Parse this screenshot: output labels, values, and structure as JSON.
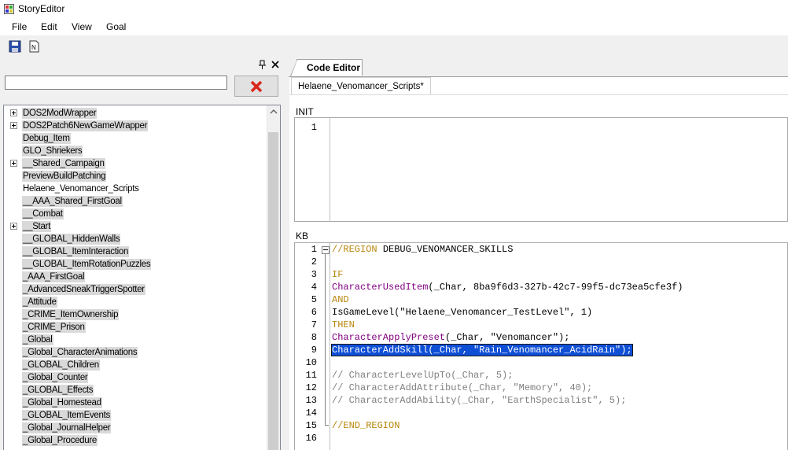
{
  "window": {
    "title": "StoryEditor"
  },
  "menu": [
    "File",
    "Edit",
    "View",
    "Goal"
  ],
  "toolbar": {
    "save_icon": "save-icon",
    "document_icon": "document-icon"
  },
  "left_pane": {
    "filter_value": "",
    "tree_items": [
      {
        "label": "DOS2ModWrapper",
        "expandable": true,
        "highlight": true
      },
      {
        "label": "DOS2Patch6NewGameWrapper",
        "expandable": true,
        "highlight": true
      },
      {
        "label": "Debug_Item",
        "expandable": false,
        "highlight": true
      },
      {
        "label": "GLO_Shriekers",
        "expandable": false,
        "highlight": true
      },
      {
        "label": "__Shared_Campaign",
        "expandable": true,
        "highlight": true
      },
      {
        "label": "PreviewBuildPatching",
        "expandable": false,
        "highlight": true
      },
      {
        "label": "Helaene_Venomancer_Scripts",
        "expandable": false,
        "highlight": false
      },
      {
        "label": "__AAA_Shared_FirstGoal",
        "expandable": false,
        "highlight": true
      },
      {
        "label": "__Combat",
        "expandable": false,
        "highlight": true
      },
      {
        "label": "__Start",
        "expandable": true,
        "highlight": true
      },
      {
        "label": "__GLOBAL_HiddenWalls",
        "expandable": false,
        "highlight": true
      },
      {
        "label": "__GLOBAL_ItemInteraction",
        "expandable": false,
        "highlight": true
      },
      {
        "label": "__GLOBAL_ItemRotationPuzzles",
        "expandable": false,
        "highlight": true
      },
      {
        "label": "_AAA_FirstGoal",
        "expandable": false,
        "highlight": true
      },
      {
        "label": "_AdvancedSneakTriggerSpotter",
        "expandable": false,
        "highlight": true
      },
      {
        "label": "_Attitude",
        "expandable": false,
        "highlight": true
      },
      {
        "label": "_CRIME_ItemOwnership",
        "expandable": false,
        "highlight": true
      },
      {
        "label": "_CRIME_Prison",
        "expandable": false,
        "highlight": true
      },
      {
        "label": "_Global",
        "expandable": false,
        "highlight": true
      },
      {
        "label": "_Global_CharacterAnimations",
        "expandable": false,
        "highlight": true
      },
      {
        "label": "_GLOBAL_Children",
        "expandable": false,
        "highlight": true
      },
      {
        "label": "_Global_Counter",
        "expandable": false,
        "highlight": true
      },
      {
        "label": "_GLOBAL_Effects",
        "expandable": false,
        "highlight": true
      },
      {
        "label": "_Global_Homestead",
        "expandable": false,
        "highlight": true
      },
      {
        "label": "_GLOBAL_ItemEvents",
        "expandable": false,
        "highlight": true
      },
      {
        "label": "_Global_JournalHelper",
        "expandable": false,
        "highlight": true
      },
      {
        "label": "_Global_Procedure",
        "expandable": false,
        "highlight": true
      }
    ]
  },
  "right_pane": {
    "tab_label": "Code Editor",
    "document_tab": "Helaene_Venomancer_Scripts*",
    "init_label": "INIT",
    "init_lines": [
      "1"
    ],
    "kb_label": "KB",
    "kb_lines": [
      [
        {
          "t": "//REGION ",
          "c": "kw"
        },
        {
          "t": "DEBUG_VENOMANCER_SKILLS",
          "c": ""
        }
      ],
      [],
      [
        {
          "t": "IF",
          "c": "kw"
        }
      ],
      [
        {
          "t": "CharacterUsedItem",
          "c": "fn"
        },
        {
          "t": "(_Char, 8ba9f6d3-327b-42c7-99f5-dc73ea5cfe3f)",
          "c": ""
        }
      ],
      [
        {
          "t": "AND",
          "c": "kw"
        }
      ],
      [
        {
          "t": "IsGameLevel(\"Helaene_Venomancer_TestLevel\", 1)",
          "c": ""
        }
      ],
      [
        {
          "t": "THEN",
          "c": "kw"
        }
      ],
      [
        {
          "t": "CharacterApplyPreset",
          "c": "fn"
        },
        {
          "t": "(_Char, \"Venomancer\");",
          "c": ""
        }
      ],
      [
        {
          "t": "CharacterAddSkill(_Char, \"Rain_Venomancer_AcidRain\");",
          "c": "sel"
        }
      ],
      [],
      [
        {
          "t": "// CharacterLevelUpTo(_Char, 5);",
          "c": "cmt"
        }
      ],
      [
        {
          "t": "// CharacterAddAttribute(_Char, \"Memory\", 40);",
          "c": "cmt"
        }
      ],
      [
        {
          "t": "// CharacterAddAbility(_Char, \"EarthSpecialist\", 5);",
          "c": "cmt"
        }
      ],
      [],
      [
        {
          "t": "//END_REGION",
          "c": "kw"
        }
      ],
      []
    ]
  }
}
